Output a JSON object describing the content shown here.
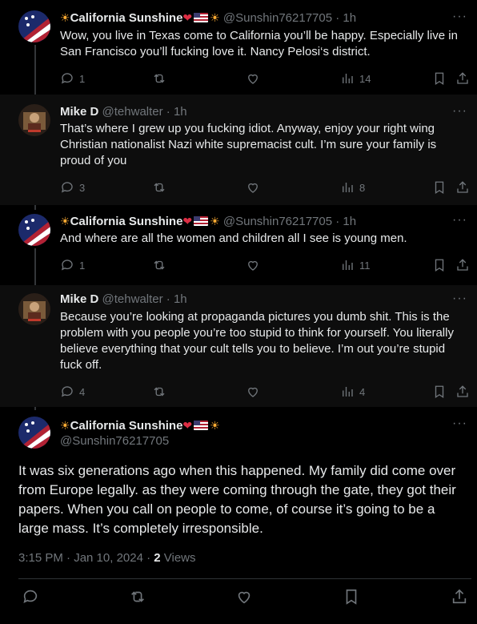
{
  "tweets": [
    {
      "name": "California Sunshine",
      "handle": "@Sunshin76217705",
      "time": "· 1h",
      "text": "Wow, you live in Texas come to California you’ll be happy. Especially live in San Francisco you’ll fucking love it. Nancy Pelosi‘s district.",
      "replies": "1",
      "retweets": "",
      "likes": "",
      "views": "14"
    },
    {
      "name": "Mike D",
      "handle": "@tehwalter",
      "time": "· 1h",
      "text": "That’s where I grew up you fucking idiot. Anyway, enjoy your right wing Christian nationalist Nazi white supremacist cult.  I’m sure your family is proud of you",
      "replies": "3",
      "retweets": "",
      "likes": "",
      "views": "8"
    },
    {
      "name": "California Sunshine",
      "handle": "@Sunshin76217705",
      "time": "· 1h",
      "text": "And where are all the women and children all I see is young men.",
      "replies": "1",
      "retweets": "",
      "likes": "",
      "views": "11"
    },
    {
      "name": "Mike D",
      "handle": "@tehwalter",
      "time": "· 1h",
      "text": "Because you’re looking at propaganda pictures you dumb shit. This is the problem with you people you’re too stupid to think for yourself. You literally believe everything that your cult tells you to believe. I’m out you’re stupid fuck off.",
      "replies": "4",
      "retweets": "",
      "likes": "",
      "views": "4"
    }
  ],
  "main_tweet": {
    "name": "California Sunshine",
    "handle": "@Sunshin76217705",
    "text": "It was six generations ago when this happened. My family did come over from Europe legally. as they were coming through the gate, they got their papers. When you call on people to come, of course it’s going to be a large mass. It’s completely irresponsible.",
    "timestamp": "3:15 PM · Jan 10, 2024 · ",
    "views_count": "2",
    "views_label": " Views"
  },
  "more_label": "···",
  "colors": {
    "muted": "#71767b",
    "text": "#e7e9ea",
    "sun": "#ffac33",
    "heart": "#dd2e44",
    "bg": "#000000"
  },
  "icons": [
    "reply-icon",
    "retweet-icon",
    "like-icon",
    "views-icon",
    "bookmark-icon",
    "share-icon"
  ]
}
